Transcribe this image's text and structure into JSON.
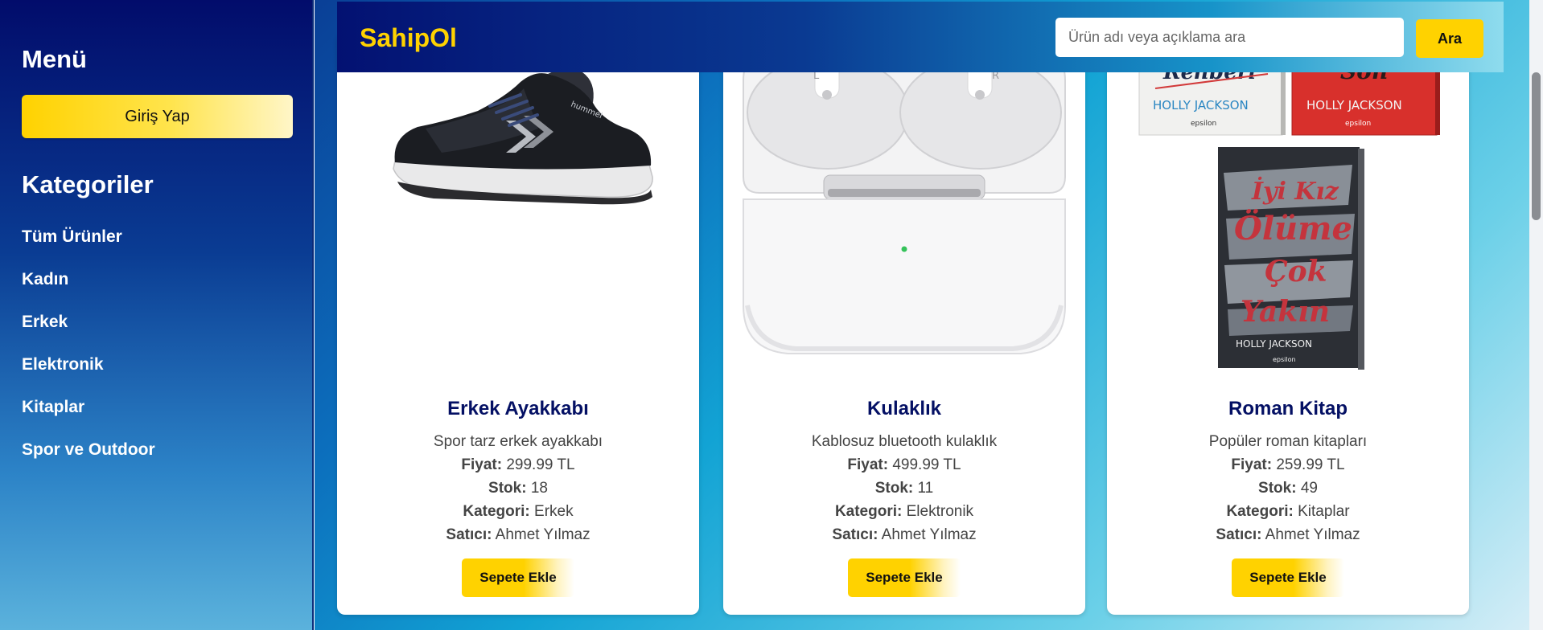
{
  "sidebar": {
    "menu_title": "Menü",
    "login_label": "Giriş Yap",
    "categories_title": "Kategoriler",
    "categories": [
      "Tüm Ürünler",
      "Kadın",
      "Erkek",
      "Elektronik",
      "Kitaplar",
      "Spor ve Outdoor"
    ]
  },
  "header": {
    "brand": "SahipOl",
    "search_placeholder": "Ürün adı veya açıklama ara",
    "search_button": "Ara"
  },
  "labels": {
    "price": "Fiyat:",
    "stock": "Stok:",
    "category": "Kategori:",
    "seller": "Satıcı:"
  },
  "products": [
    {
      "name": "Erkek Ayakkabı",
      "description": "Spor tarz erkek ayakkabı",
      "price": "299.99 TL",
      "stock": "18",
      "category": "Erkek",
      "seller": "Ahmet Yılmaz",
      "button": "Sepete Ekle",
      "image": "sneaker-image",
      "image_brand": "hummel"
    },
    {
      "name": "Kulaklık",
      "description": "Kablosuz bluetooth kulaklık",
      "price": "499.99 TL",
      "stock": "11",
      "category": "Elektronik",
      "seller": "Ahmet Yılmaz",
      "button": "Sepete Ekle",
      "image": "earbuds-case-image",
      "image_marks": [
        "L",
        "R"
      ]
    },
    {
      "name": "Roman Kitap",
      "description": "Popüler roman kitapları",
      "price": "259.99 TL",
      "stock": "49",
      "category": "Kitaplar",
      "seller": "Ahmet Yılmaz",
      "button": "Sepete Ekle",
      "image": "books-image",
      "image_text": {
        "book_left_title": "Rehberi",
        "book_right_title": "Son",
        "author": "HOLLY JACKSON",
        "publisher": "epsilon",
        "main_book_title": [
          "İyi Kız",
          "Ölüme",
          "Çok",
          "Yakın"
        ]
      }
    }
  ],
  "colors": {
    "accent": "#ffd200",
    "title": "#041064",
    "sidebar_top": "#020c6b"
  }
}
